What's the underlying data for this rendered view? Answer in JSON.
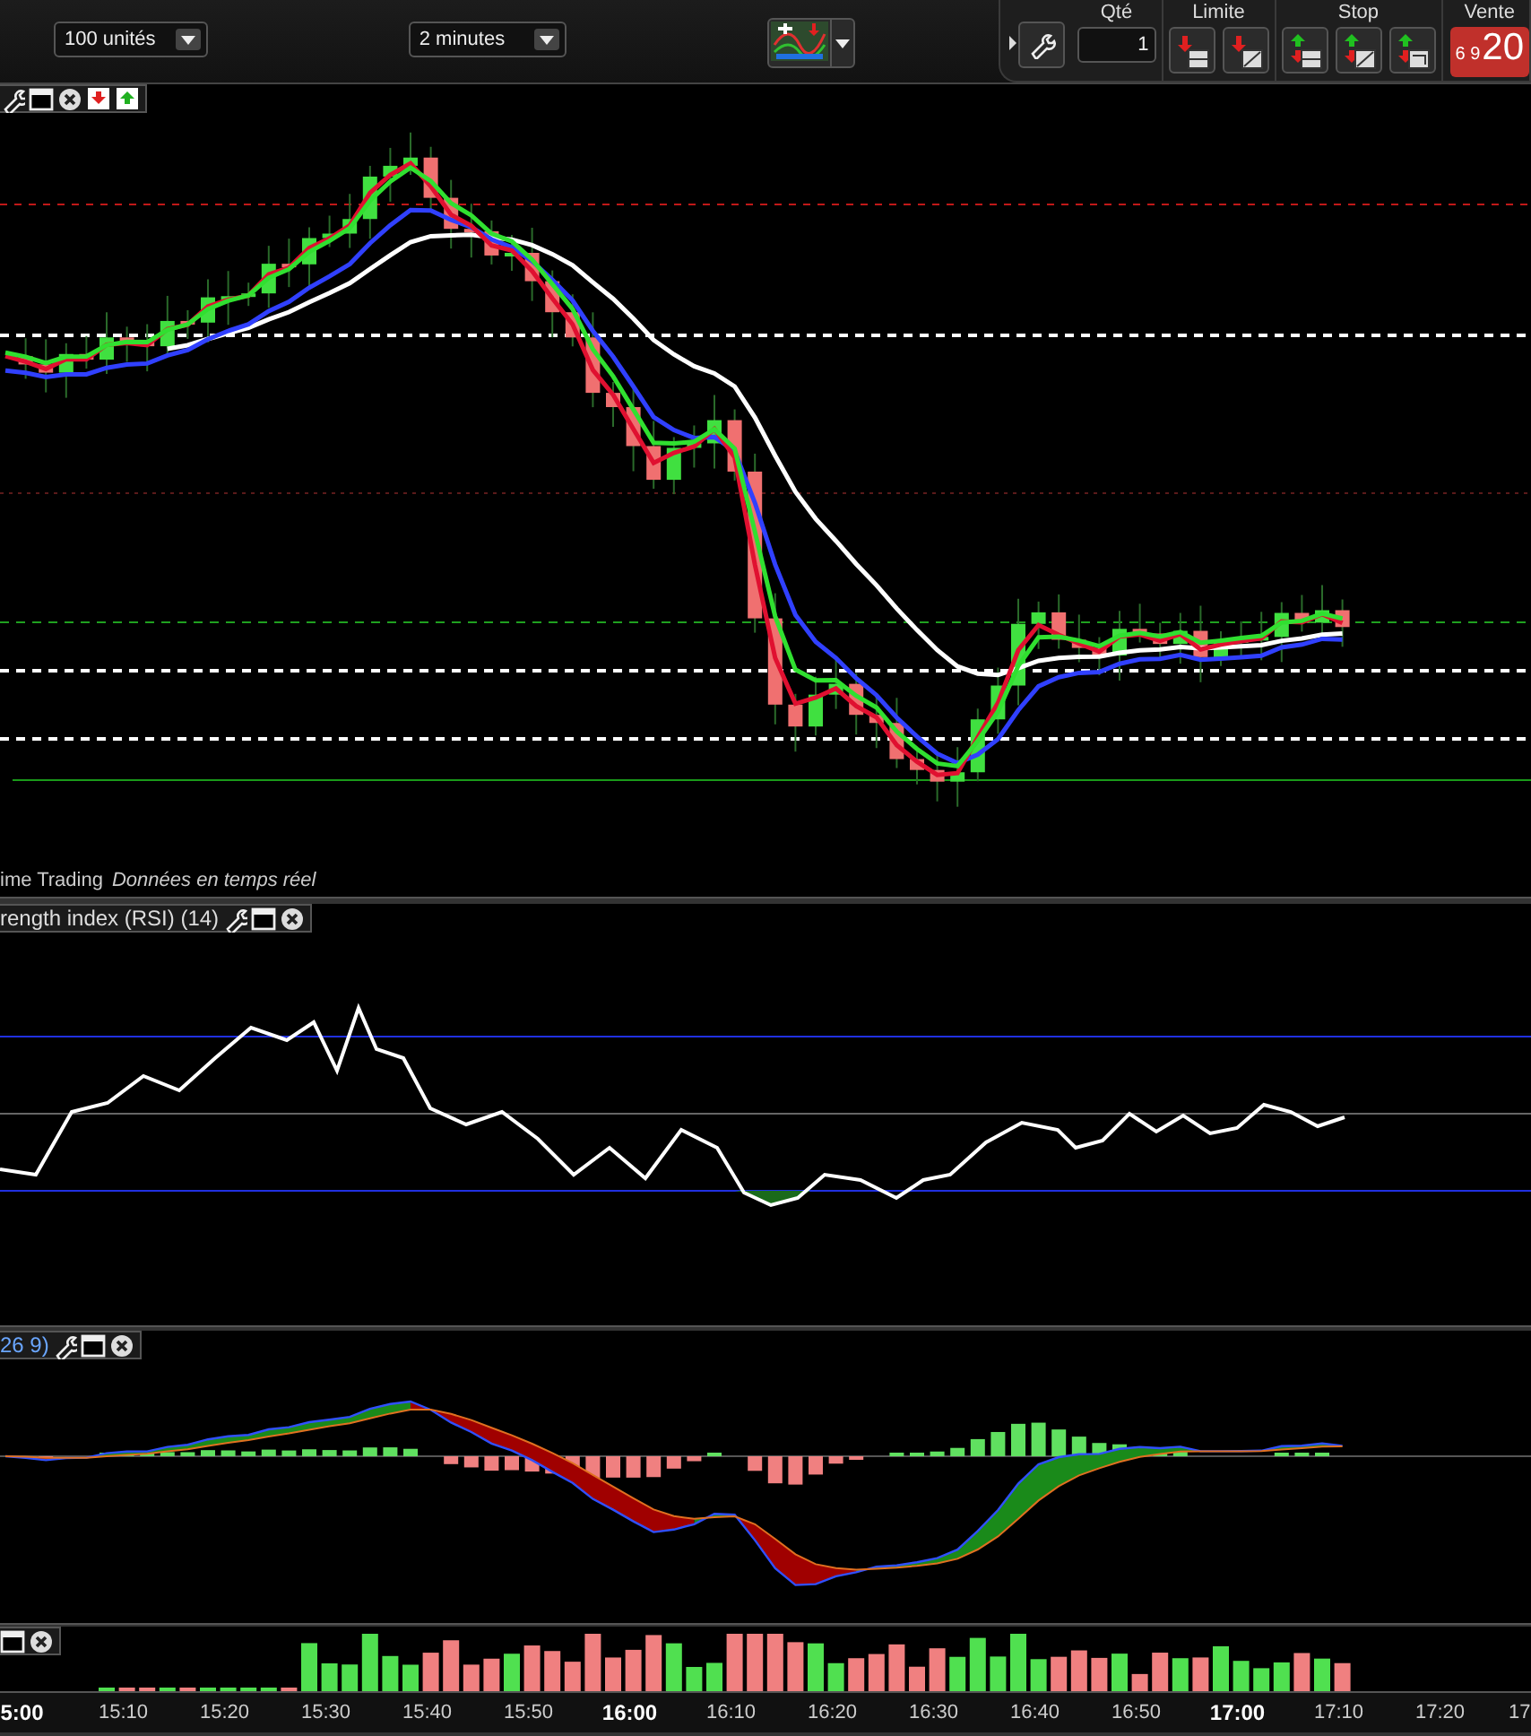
{
  "toolbar": {
    "quantity_select": "100 unités",
    "interval_select": "2 minutes"
  },
  "order_panel": {
    "qty_label": "Qté",
    "qty_value": "1",
    "limit_label": "Limite",
    "stop_label": "Stop",
    "sell_label": "Vente",
    "sell_price_small": "6 9",
    "sell_price_big": "20"
  },
  "price_panel": {
    "footer_source": "ime Trading",
    "footer_status": "Données en temps réel"
  },
  "rsi_panel": {
    "title": "rength index (RSI) (14)"
  },
  "macd_panel": {
    "title": "26 9)"
  },
  "time_axis": {
    "labels": [
      {
        "text": "5:00",
        "bold": true
      },
      {
        "text": "15:10",
        "bold": false
      },
      {
        "text": "15:20",
        "bold": false
      },
      {
        "text": "15:30",
        "bold": false
      },
      {
        "text": "15:40",
        "bold": false
      },
      {
        "text": "15:50",
        "bold": false
      },
      {
        "text": "16:00",
        "bold": true
      },
      {
        "text": "16:10",
        "bold": false
      },
      {
        "text": "16:20",
        "bold": false
      },
      {
        "text": "16:30",
        "bold": false
      },
      {
        "text": "16:40",
        "bold": false
      },
      {
        "text": "16:50",
        "bold": false
      },
      {
        "text": "17:00",
        "bold": true
      },
      {
        "text": "17:10",
        "bold": false
      },
      {
        "text": "17:20",
        "bold": false
      },
      {
        "text": "17",
        "bold": false
      }
    ]
  }
}
